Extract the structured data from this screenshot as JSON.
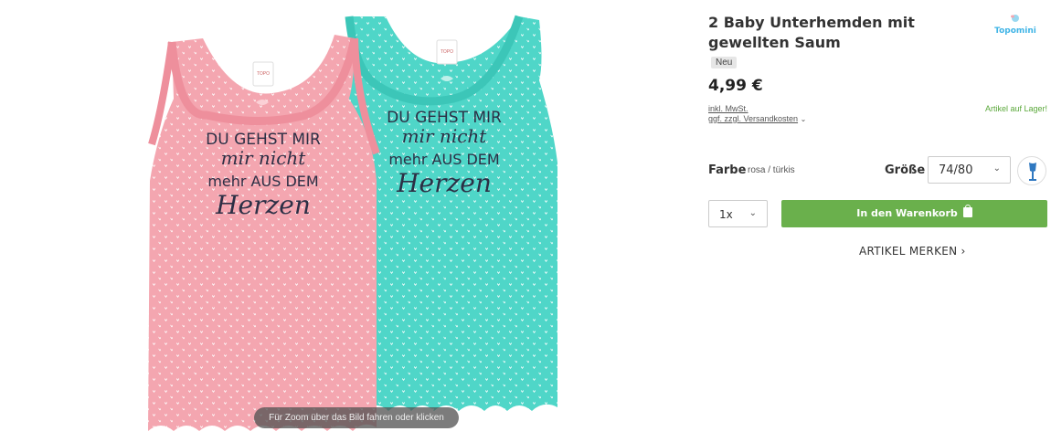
{
  "product": {
    "title": "2 Baby Unterhemden mit gewellten Saum",
    "badge": "Neu",
    "price": "4,99 €",
    "tax_note": "inkl. MwSt.",
    "shipping_note": "ggf. zzgl. Versandkosten",
    "stock_status": "Artikel auf Lager!",
    "print_text_lines": [
      "DU GEHST MIR",
      "mir nicht",
      "mehr AUS DEM",
      "Herzen"
    ]
  },
  "brand": {
    "logo_text": "Topomini",
    "color": "#3fb4e6"
  },
  "options": {
    "color_label": "Farbe",
    "color_value": "rosa / türkis",
    "size_label": "Größe",
    "size_value": "74/80",
    "quantity_value": "1x"
  },
  "actions": {
    "add_to_cart": "In den Warenkorb",
    "wishlist": "ARTIKEL MERKEN ›"
  },
  "image": {
    "zoom_hint": "Für Zoom über das Bild fahren oder klicken"
  },
  "colors": {
    "accent_green": "#6ab04c",
    "stock_green": "#5aa83a",
    "shirt_pink": "#f4a6b0",
    "shirt_turquoise": "#4fd6c8"
  },
  "icons": {
    "chevron": "chevron-down-icon",
    "bag": "shopping-bag-icon",
    "size_guide": "mannequin-icon"
  }
}
